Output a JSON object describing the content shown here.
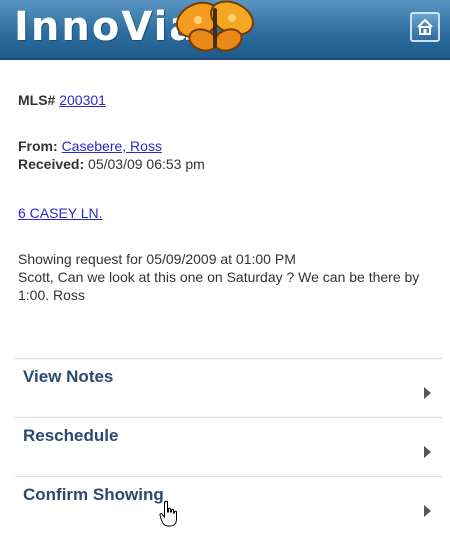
{
  "header": {
    "logo_text": "InnoVia",
    "home_icon": "home-icon",
    "brand_color": "#2e6ea0"
  },
  "listing": {
    "mls_label": "MLS#",
    "mls_number": "200301"
  },
  "request": {
    "from_label": "From:",
    "from_name": "Casebere, Ross",
    "received_label": "Received:",
    "received_value": "05/03/09 06:53 pm",
    "address": "6 CASEY LN.",
    "message_line1": "Showing request for 05/09/2009 at 01:00 PM",
    "message_body": "Scott, Can we look at this one on Saturday ? We can be there by 1:00. Ross"
  },
  "menu": [
    {
      "label": "View Notes",
      "icon": "chevron-right-icon"
    },
    {
      "label": "Reschedule",
      "icon": "chevron-right-icon"
    },
    {
      "label": "Confirm Showing",
      "icon": "chevron-right-icon"
    }
  ],
  "colors": {
    "link": "#2a2acc",
    "menu_text": "#2b4a6e"
  }
}
